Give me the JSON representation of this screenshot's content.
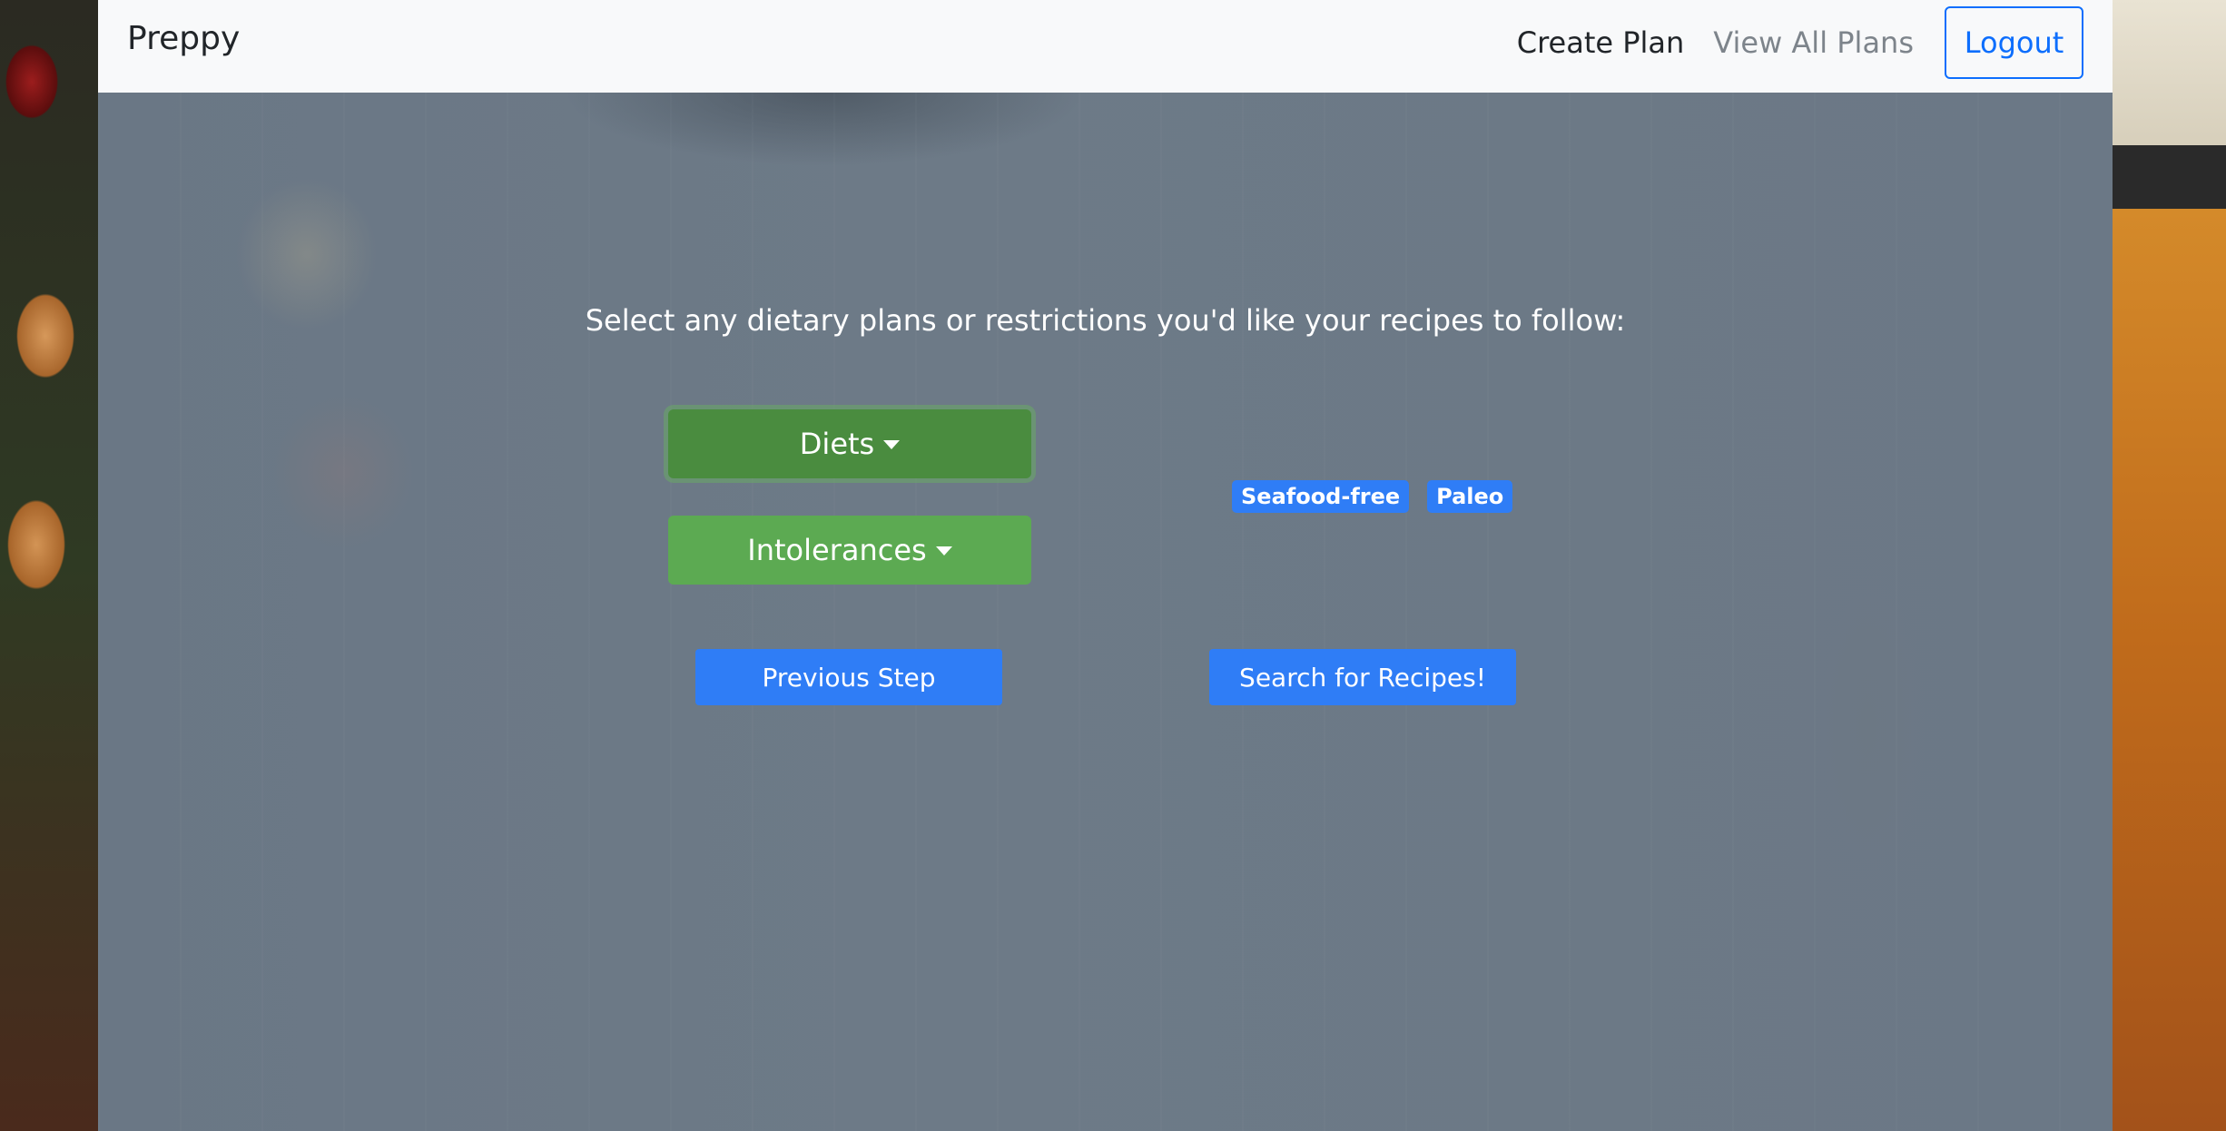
{
  "navbar": {
    "brand": "Preppy",
    "links": [
      {
        "label": "Create Plan"
      },
      {
        "label": "View All Plans"
      }
    ],
    "logout_label": "Logout"
  },
  "main": {
    "instruction": "Select any dietary plans or restrictions you'd like your recipes to follow:",
    "diets_label": "Diets",
    "intolerances_label": "Intolerances",
    "selected_badges": [
      "Seafood-free",
      "Paleo"
    ],
    "previous_label": "Previous Step",
    "search_label": "Search for Recipes!"
  },
  "colors": {
    "primary": "#2f7df6",
    "success": "#5caa52",
    "success_active": "#4a8c3f"
  }
}
